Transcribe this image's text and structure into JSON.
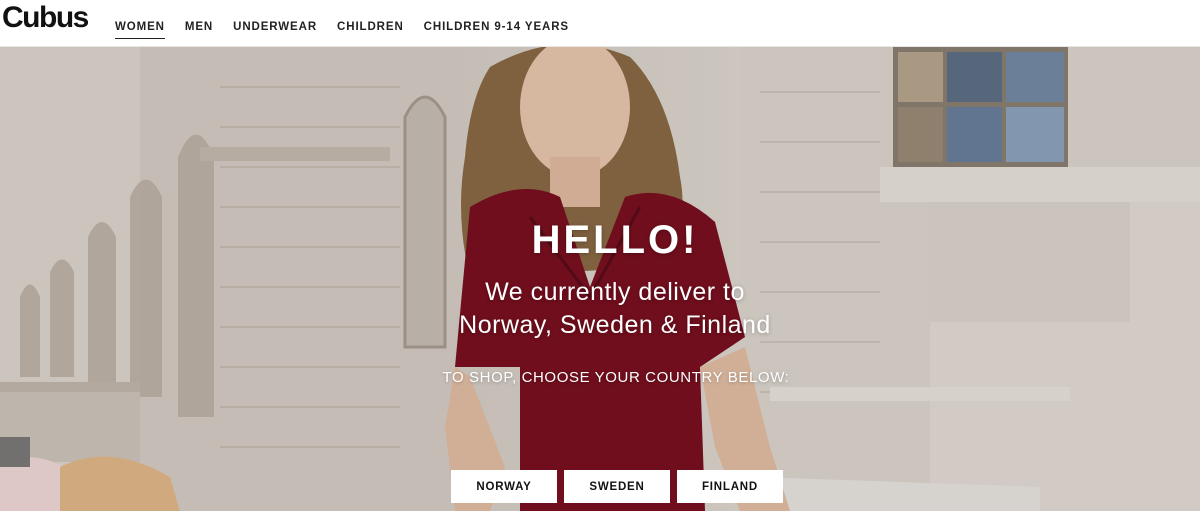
{
  "header": {
    "logo": "Cubus",
    "nav": [
      {
        "label": "WOMEN",
        "active": true
      },
      {
        "label": "MEN",
        "active": false
      },
      {
        "label": "UNDERWEAR",
        "active": false
      },
      {
        "label": "CHILDREN",
        "active": false
      },
      {
        "label": "CHILDREN 9-14 YEARS",
        "active": false
      }
    ]
  },
  "hero": {
    "title": "HELLO!",
    "line1": "We currently deliver to",
    "line2": "Norway, Sweden & Finland",
    "instruction": "TO SHOP, CHOOSE YOUR COUNTRY BELOW:",
    "buttons": [
      "NORWAY",
      "SWEDEN",
      "FINLAND"
    ]
  },
  "colors": {
    "dress": "#7a1020",
    "stone": "#d8d0c7",
    "text": "#ffffff"
  }
}
